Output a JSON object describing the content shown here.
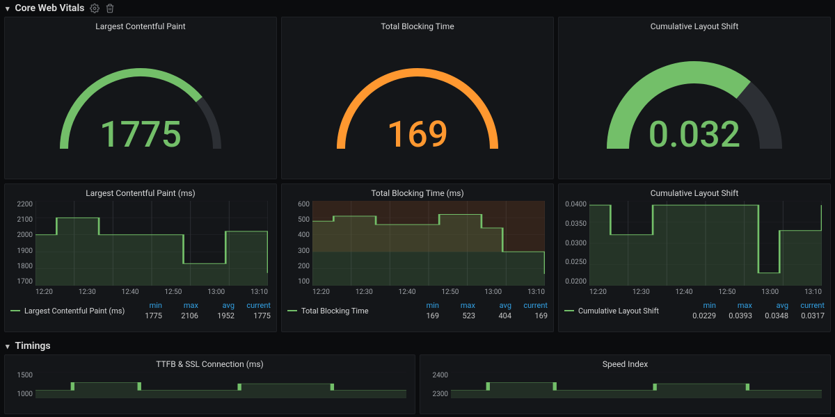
{
  "sections": {
    "cwv": {
      "title": "Core Web Vitals"
    },
    "timings": {
      "title": "Timings"
    }
  },
  "colors": {
    "green": "#73bf69",
    "orange": "#ff9830",
    "track": "#2c2f34",
    "link": "#33a2e5"
  },
  "gauges": [
    {
      "title": "Largest Contentful Paint",
      "value": "1775",
      "color": "#73bf69",
      "fill_deg": 140
    },
    {
      "title": "Total Blocking Time",
      "value": "169",
      "color": "#ff9830",
      "fill_deg": 180
    },
    {
      "title": "Cumulative Layout Shift",
      "value": "0.032",
      "color": "#73bf69",
      "fill_deg": 130,
      "thick": true
    }
  ],
  "charts": [
    {
      "title": "Largest Contentful Paint (ms)",
      "legend": "Largest Contentful Paint (ms)",
      "stats": {
        "min": "1775",
        "max": "2106",
        "avg": "1952",
        "current": "1775"
      },
      "y_ticks": [
        "2200",
        "2100",
        "2000",
        "1900",
        "1800",
        "1700"
      ],
      "x_ticks": [
        "12:20",
        "12:30",
        "12:40",
        "12:50",
        "13:00",
        "13:10"
      ]
    },
    {
      "title": "Total Blocking Time (ms)",
      "legend": "Total Blocking Time",
      "stats": {
        "min": "169",
        "max": "523",
        "avg": "404",
        "current": "169"
      },
      "y_ticks": [
        "600",
        "500",
        "400",
        "300",
        "200",
        "100"
      ],
      "x_ticks": [
        "12:20",
        "12:30",
        "12:40",
        "12:50",
        "13:00",
        "13:10"
      ],
      "threshold_band": true
    },
    {
      "title": "Cumulative Layout Shift",
      "legend": "Cumulative Layout Shift",
      "stats": {
        "min": "0.0229",
        "max": "0.0393",
        "avg": "0.0348",
        "current": "0.0317"
      },
      "y_ticks": [
        "0.0400",
        "0.0350",
        "0.0300",
        "0.0250",
        "0.0200"
      ],
      "x_ticks": [
        "12:20",
        "12:30",
        "12:40",
        "12:50",
        "13:00",
        "13:10"
      ]
    }
  ],
  "timings_charts": [
    {
      "title": "TTFB & SSL Connection (ms)",
      "y_ticks": [
        "1500",
        "1000"
      ]
    },
    {
      "title": "Speed Index",
      "y_ticks": [
        "2400",
        "2300"
      ]
    }
  ],
  "stat_labels": {
    "min": "min",
    "max": "max",
    "avg": "avg",
    "current": "current"
  },
  "chart_data": [
    {
      "type": "line",
      "title": "Largest Contentful Paint (ms)",
      "xlabel": "",
      "ylabel": "",
      "x": [
        "12:15",
        "12:20",
        "12:25",
        "12:30",
        "12:35",
        "12:40",
        "12:45",
        "12:50",
        "12:55",
        "13:00",
        "13:05",
        "13:10"
      ],
      "series": [
        {
          "name": "Largest Contentful Paint (ms)",
          "values": [
            2000,
            2100,
            2100,
            2000,
            2000,
            2000,
            2000,
            1830,
            1830,
            2020,
            2020,
            1775
          ]
        }
      ],
      "ylim": [
        1700,
        2200
      ],
      "stats": {
        "min": 1775,
        "max": 2106,
        "avg": 1952,
        "current": 1775
      }
    },
    {
      "type": "line",
      "title": "Total Blocking Time (ms)",
      "xlabel": "",
      "ylabel": "",
      "x": [
        "12:15",
        "12:20",
        "12:25",
        "12:30",
        "12:35",
        "12:40",
        "12:45",
        "12:50",
        "12:55",
        "13:00",
        "13:05",
        "13:10"
      ],
      "series": [
        {
          "name": "Total Blocking Time",
          "values": [
            480,
            510,
            510,
            460,
            460,
            460,
            520,
            520,
            440,
            300,
            300,
            169
          ]
        }
      ],
      "ylim": [
        100,
        600
      ],
      "annotations": [
        "threshold at 300"
      ],
      "stats": {
        "min": 169,
        "max": 523,
        "avg": 404,
        "current": 169
      }
    },
    {
      "type": "line",
      "title": "Cumulative Layout Shift",
      "xlabel": "",
      "ylabel": "",
      "x": [
        "12:15",
        "12:20",
        "12:25",
        "12:30",
        "12:35",
        "12:40",
        "12:45",
        "12:50",
        "12:55",
        "13:00",
        "13:05",
        "13:10"
      ],
      "series": [
        {
          "name": "Cumulative Layout Shift",
          "values": [
            0.039,
            0.032,
            0.032,
            0.039,
            0.039,
            0.039,
            0.039,
            0.039,
            0.023,
            0.033,
            0.033,
            0.039
          ]
        }
      ],
      "ylim": [
        0.02,
        0.04
      ],
      "stats": {
        "min": 0.0229,
        "max": 0.0393,
        "avg": 0.0348,
        "current": 0.0317
      }
    },
    {
      "type": "line",
      "title": "TTFB & SSL Connection (ms)",
      "x": [],
      "series": [],
      "ylim": [
        1000,
        1500
      ]
    },
    {
      "type": "line",
      "title": "Speed Index",
      "x": [],
      "series": [],
      "ylim": [
        2300,
        2400
      ]
    }
  ]
}
